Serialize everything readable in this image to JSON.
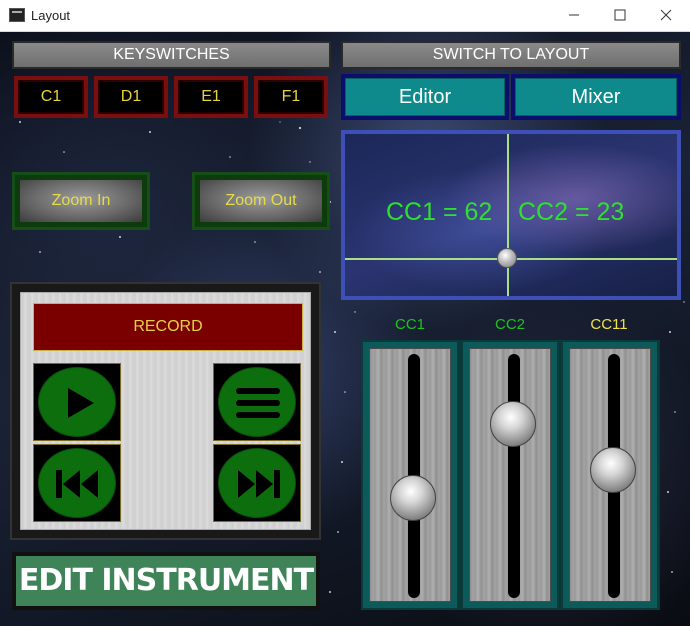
{
  "window": {
    "title": "Layout",
    "minimize_glyph": "—",
    "maximize_glyph": "☐",
    "close_glyph": "✕"
  },
  "keyswitches": {
    "header": "KEYSWITCHES",
    "buttons": [
      "C1",
      "D1",
      "E1",
      "F1"
    ]
  },
  "switch_layout": {
    "header": "SWITCH TO LAYOUT",
    "buttons": [
      "Editor",
      "Mixer"
    ]
  },
  "zoom": {
    "in_label": "Zoom In",
    "out_label": "Zoom Out"
  },
  "xy_pad": {
    "cc1_text": "CC1 = 62",
    "cc2_text": "CC2 = 23",
    "cc1_value": 62,
    "cc2_value": 23
  },
  "transport": {
    "record_label": "RECORD",
    "icons": [
      "play-icon",
      "menu-icon",
      "rewind-icon",
      "fast-forward-icon"
    ]
  },
  "edit_instrument": {
    "label": "EDIT INSTRUMENT"
  },
  "faders": [
    {
      "label": "CC1",
      "label_color": "#1ec21e",
      "level": 0.4
    },
    {
      "label": "CC2",
      "label_color": "#1ec21e",
      "level": 0.77
    },
    {
      "label": "CC11",
      "label_color": "#f0e24a",
      "level": 0.54
    }
  ],
  "colors": {
    "keyswitch_border": "#7a0f0f",
    "keyswitch_text": "#e8d43a",
    "layout_button": "#0e8a8c",
    "xy_border": "#3e4fb8",
    "xy_text": "#2fe02f",
    "record_bg": "#7a0000",
    "transport_green": "#0d6e0d",
    "edit_button": "#3f8459"
  }
}
